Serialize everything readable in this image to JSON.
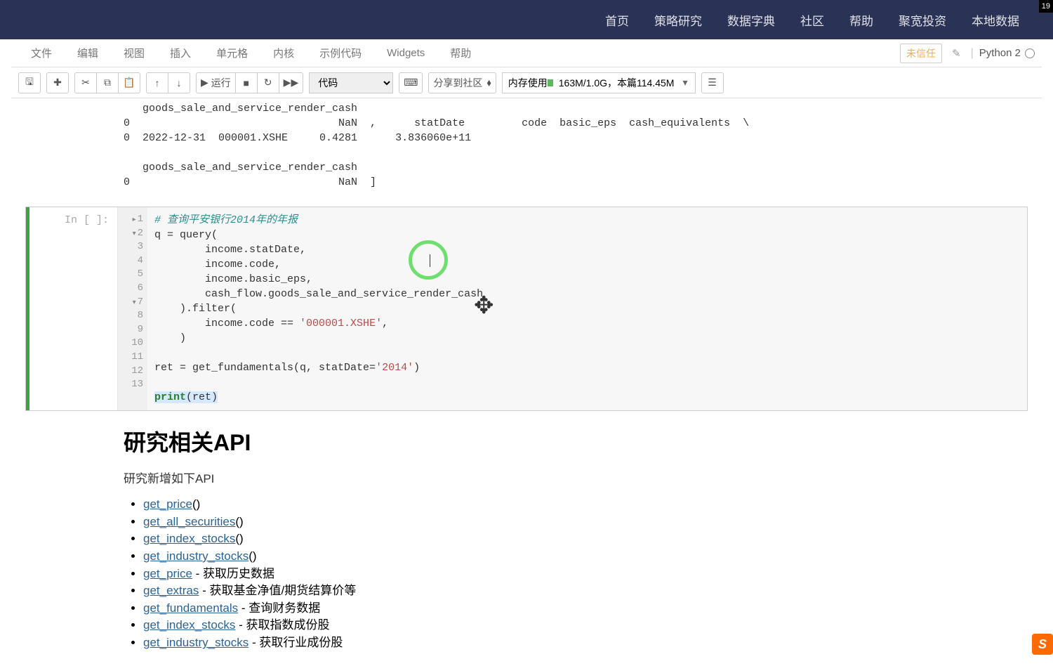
{
  "corner_badge": "19",
  "topnav": {
    "home": "首页",
    "strategy": "策略研究",
    "dictionary": "数据字典",
    "community": "社区",
    "help": "帮助",
    "invest": "聚宽投资",
    "localdata": "本地数据"
  },
  "menubar": {
    "file": "文件",
    "edit": "编辑",
    "view": "视图",
    "insert": "插入",
    "cell": "单元格",
    "kernel": "内核",
    "example": "示例代码",
    "widgets": "Widgets",
    "help": "帮助"
  },
  "trust_label": "未信任",
  "kernel_name": "Python 2",
  "toolbar": {
    "run_label": "运行",
    "cell_type": "代码",
    "share_label": "分享到社区",
    "mem_prefix": "内存使用",
    "mem_used": "163M/1.0G，本篇114.45M"
  },
  "output_prev": "   goods_sale_and_service_render_cash\n0                                 NaN  ,      statDate         code  basic_eps  cash_equivalents  \\\n0  2022-12-31  000001.XSHE     0.4281      3.836060e+11\n\n   goods_sale_and_service_render_cash\n0                                 NaN  ]",
  "code_cell": {
    "prompt": "In [ ]:",
    "lines": [
      {
        "n": "1",
        "fold": "▸"
      },
      {
        "n": "2",
        "fold": "▾"
      },
      {
        "n": "3"
      },
      {
        "n": "4"
      },
      {
        "n": "5"
      },
      {
        "n": "6"
      },
      {
        "n": "7",
        "fold": "▾"
      },
      {
        "n": "8"
      },
      {
        "n": "9"
      },
      {
        "n": "10"
      },
      {
        "n": "11"
      },
      {
        "n": "12"
      },
      {
        "n": "13"
      }
    ],
    "l1_comment": "# 查询平安银行2014年的年报",
    "l2": "q = query(",
    "l3": "        income.statDate,",
    "l4": "        income.code,",
    "l5": "        income.basic_eps,",
    "l6": "        cash_flow.goods_sale_and_service_render_cash",
    "l7": "    ).filter(",
    "l8a": "        income.code == ",
    "l8_str": "'000001.XSHE'",
    "l8b": ",",
    "l9": "    )",
    "l11a": "ret = get_fundamentals(q, statDate=",
    "l11_str": "'2014'",
    "l11b": ")",
    "l13_print": "print",
    "l13_rest": "(ret)"
  },
  "section": {
    "heading": "研究相关API",
    "intro": "研究新增如下API",
    "items": [
      {
        "fn": "get_price",
        "suffix": "()"
      },
      {
        "fn": "get_all_securities",
        "suffix": "()"
      },
      {
        "fn": "get_index_stocks",
        "suffix": "()"
      },
      {
        "fn": "get_industry_stocks",
        "suffix": "()"
      },
      {
        "fn": "get_price",
        "suffix": " - 获取历史数据"
      },
      {
        "fn": "get_extras",
        "suffix": " - 获取基金净值/期货结算价等"
      },
      {
        "fn": "get_fundamentals",
        "suffix": " - 查询财务数据"
      },
      {
        "fn": "get_index_stocks",
        "suffix": " - 获取指数成份股"
      },
      {
        "fn": "get_industry_stocks",
        "suffix": " - 获取行业成份股"
      }
    ]
  },
  "sogou": "S"
}
